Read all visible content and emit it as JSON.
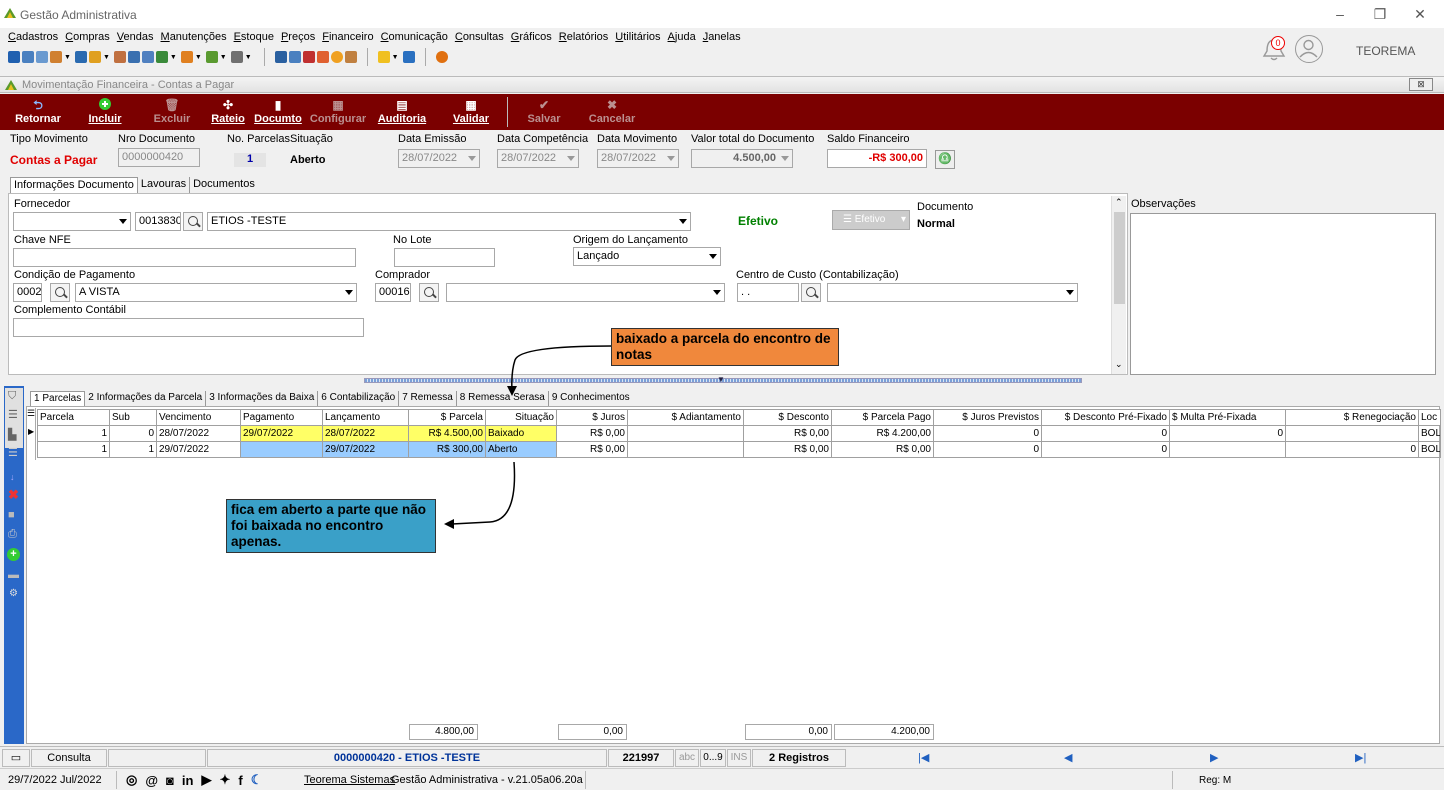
{
  "window": {
    "title": "Gestão Administrativa",
    "user": "TEOREMA",
    "notifications": "0"
  },
  "menu": [
    "Cadastros",
    "Compras",
    "Vendas",
    "Manutenções",
    "Estoque",
    "Preços",
    "Financeiro",
    "Comunicação",
    "Consultas",
    "Gráficos",
    "Relatórios",
    "Utilitários",
    "Ajuda",
    "Janelas"
  ],
  "form": {
    "title": "Movimentação Financeira - Contas a Pagar",
    "close": "⊠"
  },
  "toolbar": {
    "retornar": "Retornar",
    "incluir": "Incluir",
    "excluir": "Excluir",
    "rateio": "Rateio",
    "documto": "Documto",
    "configurar": "Configurar",
    "auditoria": "Auditoria",
    "validar": "Validar",
    "salvar": "Salvar",
    "cancelar": "Cancelar"
  },
  "header": {
    "tipo_label": "Tipo Movimento",
    "tipo_value": "Contas a Pagar",
    "nro_label": "Nro Documento",
    "nro_value": "0000000420",
    "parc_label": "No. Parcelas",
    "parc_value": "1",
    "sit_label": "Situação",
    "sit_value": "Aberto",
    "emissao_label": "Data Emissão",
    "emissao_value": "28/07/2022",
    "comp_label": "Data Competência",
    "comp_value": "28/07/2022",
    "mov_label": "Data Movimento",
    "mov_value": "28/07/2022",
    "total_label": "Valor total do Documento",
    "total_value": "4.500,00",
    "saldo_label": "Saldo Financeiro",
    "saldo_value": "-R$ 300,00"
  },
  "tabs1": [
    "Informações Documento",
    "Lavouras",
    "Documentos"
  ],
  "doc": {
    "fornecedor_label": "Fornecedor",
    "fornecedor_code": "0013830",
    "fornecedor_name": "ETIOS -TESTE",
    "efetivo": "Efetivo",
    "efetivo_btn": "Efetivo",
    "documento_label": "Documento",
    "documento_value": "Normal",
    "observacoes_label": "Observações",
    "chave_label": "Chave NFE",
    "lote_label": "No Lote",
    "origem_label": "Origem do Lançamento",
    "origem_value": "Lançado",
    "cond_label": "Condição de Pagamento",
    "cond_code": "0002",
    "cond_name": "A VISTA",
    "comprador_label": "Comprador",
    "comprador_code": "00016",
    "cc_label": "Centro de Custo (Contabilização)",
    "cc_value": ". .",
    "compl_label": "Complemento Contábil"
  },
  "tabs2": [
    "1 Parcelas",
    "2 Informações da Parcela",
    "3 Informações da Baixa",
    "6 Contabilização",
    "7 Remessa",
    "8 Remessa Serasa",
    "9 Conhecimentos"
  ],
  "grid": {
    "headers": [
      "Parcela",
      "Sub",
      "Vencimento",
      "Pagamento",
      "Lançamento",
      "$ Parcela",
      "Situação",
      "$ Juros",
      "$ Adiantamento",
      "$ Desconto",
      "$ Parcela Pago",
      "$ Juros Previstos",
      "$ Desconto Pré-Fixado",
      "$ Multa Pré-Fixada",
      "$ Renegociação",
      "Loc"
    ],
    "rows": [
      [
        "1",
        "0",
        "28/07/2022",
        "29/07/2022",
        "28/07/2022",
        "R$ 4.500,00",
        "Baixado",
        "R$ 0,00",
        "",
        "R$ 0,00",
        "R$ 4.200,00",
        "0",
        "0",
        "0",
        "",
        "BOL"
      ],
      [
        "1",
        "1",
        "29/07/2022",
        "",
        "29/07/2022",
        "R$ 300,00",
        "Aberto",
        "R$ 0,00",
        "",
        "R$ 0,00",
        "R$ 0,00",
        "0",
        "0",
        "",
        "0",
        "BOL"
      ]
    ],
    "totals": {
      "parcela": "4.800,00",
      "juros": "0,00",
      "desconto": "0,00",
      "pago": "4.200,00"
    }
  },
  "notes": {
    "n1": "baixado a parcela do encontro de notas",
    "n2": "fica em aberto a parte que não foi baixada no encontro apenas."
  },
  "status": {
    "mode": "Consulta",
    "record": "0000000420 - ETIOS -TESTE",
    "id": "221997",
    "abc": "abc",
    "num": "0...9",
    "ins": "INS",
    "count": "2 Registros"
  },
  "bottom": {
    "date": "29/7/2022 Jul/2022",
    "company": "Teorema Sistemas",
    "version": "Gestão Administrativa - v.21.05a06.20a",
    "reg": "Reg: M"
  },
  "colors": {
    "toolbar": "#7b0000",
    "note1": "#f0883c",
    "note2": "#3aa0c8",
    "baixado": "#ffff66",
    "aberto": "#99ccff",
    "red": "#e00000",
    "green": "#008000"
  }
}
